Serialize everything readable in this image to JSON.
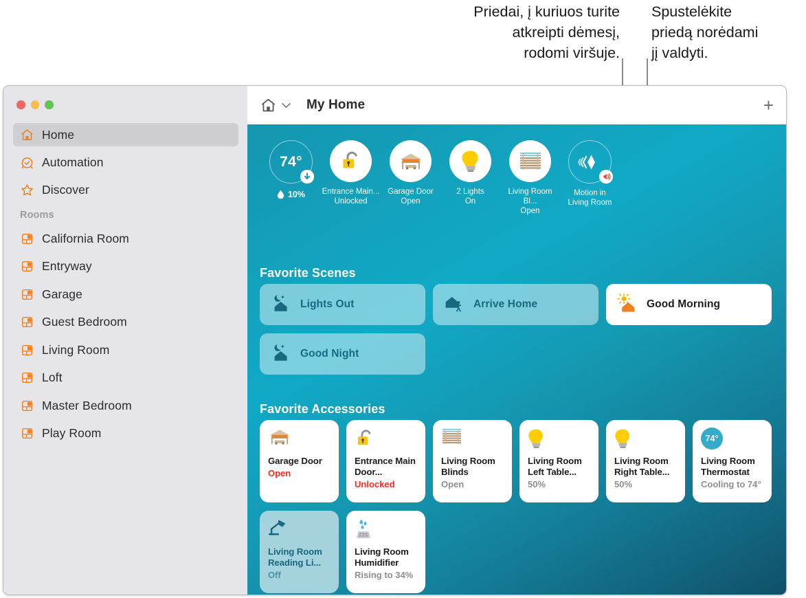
{
  "callouts": {
    "left": "Priedai, į kuriuos turite\natkreipti dėmesį,\nrodomi viršuje.",
    "right": "Spustelėkite\npriedą norėdami\njį valdyti."
  },
  "window": {
    "traffic_lights": [
      "close-button",
      "minimize-button",
      "zoom-button"
    ]
  },
  "sidebar": {
    "nav": [
      {
        "label": "Home",
        "icon": "home-icon",
        "selected": true
      },
      {
        "label": "Automation",
        "icon": "clock-check-icon",
        "selected": false
      },
      {
        "label": "Discover",
        "icon": "star-icon",
        "selected": false
      }
    ],
    "rooms_header": "Rooms",
    "rooms": [
      {
        "label": "California Room",
        "icon": "room-icon"
      },
      {
        "label": "Entryway",
        "icon": "room-icon"
      },
      {
        "label": "Garage",
        "icon": "room-icon"
      },
      {
        "label": "Guest Bedroom",
        "icon": "room-icon"
      },
      {
        "label": "Living Room",
        "icon": "room-icon"
      },
      {
        "label": "Loft",
        "icon": "room-icon"
      },
      {
        "label": "Master Bedroom",
        "icon": "room-icon"
      },
      {
        "label": "Play Room",
        "icon": "room-icon"
      }
    ]
  },
  "titlebar": {
    "home_icon": "home-icon",
    "chevron": "⌄",
    "title": "My Home",
    "add_label": "+"
  },
  "status": {
    "temperature": "74°",
    "humidity": "10%",
    "items": [
      {
        "name": "Entrance Main...",
        "state": "Unlocked",
        "icon": "unlocked-padlock-icon"
      },
      {
        "name": "Garage Door",
        "state": "Open",
        "icon": "garage-icon"
      },
      {
        "name": "2 Lights",
        "state": "On",
        "icon": "lightbulb-icon"
      },
      {
        "name": "Living Room Bl...",
        "state": "Open",
        "icon": "blinds-icon"
      },
      {
        "name": "Motion in",
        "state": "Living Room",
        "icon": "motion-sensor-icon"
      }
    ]
  },
  "scenes": {
    "heading": "Favorite Scenes",
    "items": [
      {
        "label": "Lights Out",
        "icon": "moon-house-icon",
        "on": false
      },
      {
        "label": "Arrive Home",
        "icon": "house-person-icon",
        "on": false
      },
      {
        "label": "Good Morning",
        "icon": "sun-house-icon",
        "on": true
      },
      {
        "label": "Good Night",
        "icon": "moon-house-icon",
        "on": false
      }
    ]
  },
  "accessories": {
    "heading": "Favorite Accessories",
    "items": [
      {
        "name": "Garage Door",
        "state": "Open",
        "icon": "garage-icon",
        "alert": true,
        "active": false
      },
      {
        "name": "Entrance Main Door...",
        "state": "Unlocked",
        "icon": "unlocked-padlock-icon",
        "alert": true,
        "active": false
      },
      {
        "name": "Living Room Blinds",
        "state": "Open",
        "icon": "blinds-icon",
        "alert": false,
        "active": false
      },
      {
        "name": "Living Room Left Table...",
        "state": "50%",
        "icon": "lightbulb-icon",
        "alert": false,
        "active": false
      },
      {
        "name": "Living Room Right Table...",
        "state": "50%",
        "icon": "lightbulb-icon",
        "alert": false,
        "active": false
      },
      {
        "name": "Living Room Thermostat",
        "state": "Cooling to 74°",
        "icon": "thermostat-icon",
        "alert": false,
        "active": false,
        "chip": "74°"
      },
      {
        "name": "Living Room Reading Li...",
        "state": "Off",
        "icon": "desk-lamp-icon",
        "alert": false,
        "active": true
      },
      {
        "name": "Living Room Humidifier",
        "state": "Rising to 34%",
        "icon": "humidifier-icon",
        "alert": false,
        "active": false
      }
    ]
  },
  "colors": {
    "accent_orange": "#f08021",
    "alert_red": "#fa2a1f",
    "teal_dark": "#0f4f68",
    "teal_bright": "#10a9c6",
    "scene_text": "#18697f"
  }
}
